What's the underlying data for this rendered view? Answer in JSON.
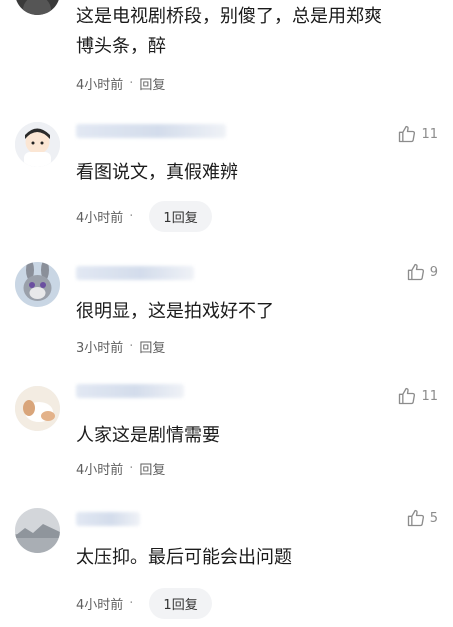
{
  "comments": [
    {
      "text": "这是电视剧桥段，别傻了，总是用郑爽\n博头条，醉",
      "time": "4小时前",
      "reply": "回复"
    },
    {
      "likes": "11",
      "text": "看图说文，真假难辨",
      "time": "4小时前",
      "reply": "1回复"
    },
    {
      "likes": "9",
      "text": "很明显，这是拍戏好不了",
      "time": "3小时前",
      "reply": "回复"
    },
    {
      "likes": "11",
      "text": "人家这是剧情需要",
      "time": "4小时前",
      "reply": "回复"
    },
    {
      "likes": "5",
      "text": "太压抑。最后可能会出问题",
      "time": "4小时前",
      "reply": "1回复"
    }
  ],
  "meta_separator": "·",
  "icons": {
    "like": "thumbs-up-icon"
  },
  "colors": {
    "text": "#1b1b1b",
    "meta": "#5f5f5f",
    "like": "#8c8c8c",
    "reply_pill_bg": "#f2f3f5"
  }
}
